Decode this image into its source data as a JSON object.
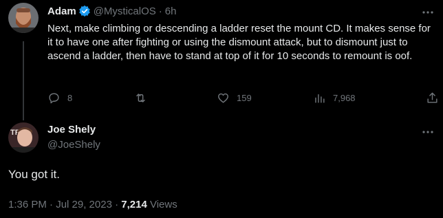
{
  "parent": {
    "name": "Adam",
    "handle": "@MysticalOS",
    "separator": "·",
    "time": "6h",
    "text": "Next, make climbing or descending a ladder reset the mount CD. It makes sense for it to have one after fighting or using the dismount attack, but to dismount just to ascend a ladder, then have to stand at top of it for 10 seconds to remount is oof.",
    "replies": "8",
    "likes": "159",
    "views": "7,968"
  },
  "reply": {
    "name": "Joe Shely",
    "handle": "@JoeShely",
    "text": "You got it.",
    "timestamp": "1:36 PM · Jul 29, 2023 ·",
    "views_count": "7,214",
    "views_label": "Views"
  },
  "colors": {
    "background": "#000000",
    "text": "#e7e9ea",
    "muted": "#71767b",
    "verified": "#1d9bf0",
    "line": "#333639"
  },
  "icons": [
    "verified-icon",
    "more-icon",
    "reply-icon",
    "retweet-icon",
    "like-icon",
    "views-icon",
    "share-icon"
  ]
}
